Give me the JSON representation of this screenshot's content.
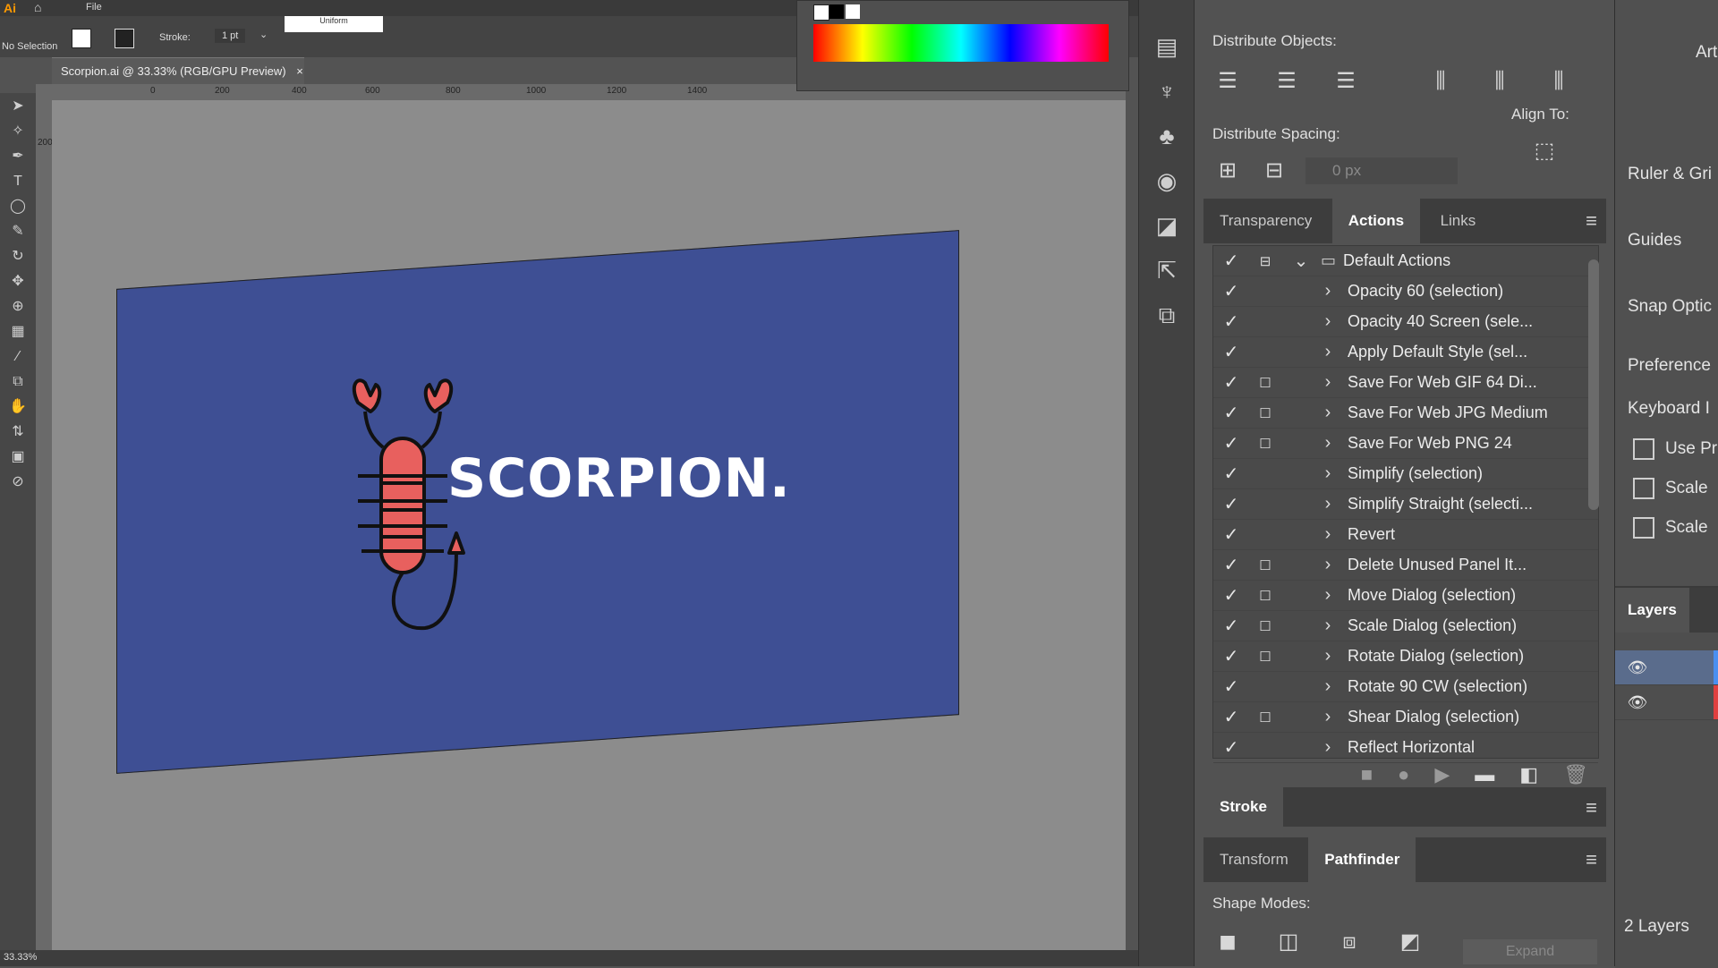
{
  "app": {
    "icon_text": "Ai",
    "menu_file": "File"
  },
  "control_bar": {
    "selection_label": "No Selection",
    "stroke_label": "Stroke:",
    "stroke_value": "1 pt",
    "brush_label": "Uniform"
  },
  "document": {
    "tab_title": "Scorpion.ai @ 33.33% (RGB/GPU Preview)",
    "close_icon": "×"
  },
  "ruler": {
    "ticks": [
      "0",
      "200",
      "400",
      "600",
      "800",
      "1000",
      "1200",
      "1400"
    ],
    "vticks": [
      "200"
    ]
  },
  "artboard": {
    "background": "#3e4f94",
    "logo_text": "SCORPION.",
    "scorpion_color": "#e8605e"
  },
  "align_panel": {
    "distribute_objects_label": "Distribute Objects:",
    "distribute_spacing_label": "Distribute Spacing:",
    "spacing_value": "0 px",
    "align_to_label": "Align To:"
  },
  "actions_panel": {
    "tabs": [
      "Transparency",
      "Actions",
      "Links"
    ],
    "active_tab": "Actions",
    "set_name": "Default Actions",
    "items": [
      {
        "label": "Opacity 60 (selection)",
        "dialog": false
      },
      {
        "label": "Opacity 40 Screen (sele...",
        "dialog": false
      },
      {
        "label": "Apply Default Style (sel...",
        "dialog": false
      },
      {
        "label": "Save For Web GIF 64 Di...",
        "dialog": true
      },
      {
        "label": "Save For Web JPG Medium",
        "dialog": true
      },
      {
        "label": "Save For Web PNG 24",
        "dialog": true
      },
      {
        "label": "Simplify (selection)",
        "dialog": false
      },
      {
        "label": "Simplify Straight (selecti...",
        "dialog": false
      },
      {
        "label": "Revert",
        "dialog": false
      },
      {
        "label": "Delete Unused Panel It...",
        "dialog": true
      },
      {
        "label": "Move Dialog (selection)",
        "dialog": true
      },
      {
        "label": "Scale Dialog (selection)",
        "dialog": true
      },
      {
        "label": "Rotate Dialog (selection)",
        "dialog": true
      },
      {
        "label": "Rotate 90 CW (selection)",
        "dialog": false
      },
      {
        "label": "Shear Dialog (selection)",
        "dialog": true
      },
      {
        "label": "Reflect Horizontal",
        "dialog": false
      }
    ]
  },
  "stroke_panel": {
    "tab": "Stroke"
  },
  "pathfinder_panel": {
    "tabs": [
      "Transform",
      "Pathfinder"
    ],
    "active_tab": "Pathfinder",
    "shape_modes_label": "Shape Modes:",
    "expand_label": "Expand"
  },
  "right_panel": {
    "items": [
      "Art",
      "Ruler & Gri",
      "Guides",
      "Snap Optic",
      "Preference",
      "Keyboard I"
    ],
    "checkboxes": [
      "Use Pr",
      "Scale",
      "Scale"
    ],
    "layers_tab": "Layers",
    "layers_count": "2 Layers",
    "layer_colors": [
      "#4a8ff0",
      "#e04040"
    ]
  },
  "status": {
    "zoom": "33.33%"
  }
}
